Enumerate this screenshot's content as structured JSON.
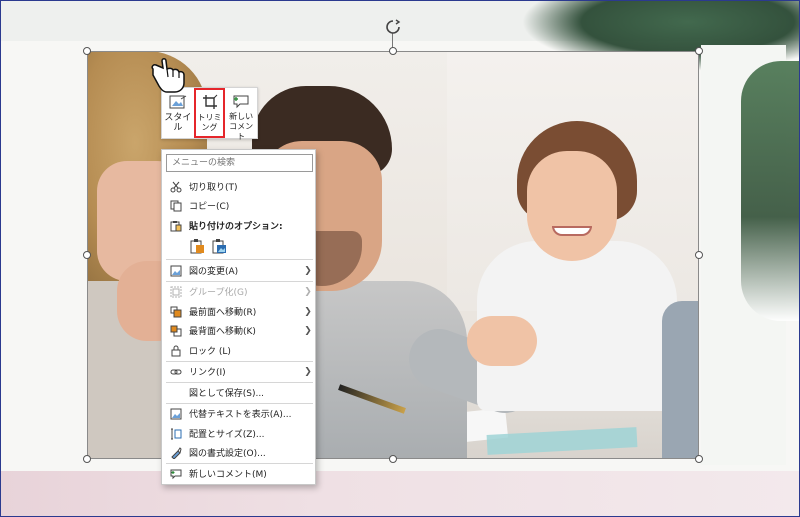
{
  "mini_toolbar": {
    "style_label": "スタイル",
    "crop_label": "トリミング",
    "new_comment_label": "新しいコメント"
  },
  "context_menu": {
    "search_placeholder": "メニューの検索",
    "cut": "切り取り(T)",
    "copy": "コピー(C)",
    "paste_options": "貼り付けのオプション:",
    "change_picture": "図の変更(A)",
    "group": "グループ化(G)",
    "bring_to_front": "最前面へ移動(R)",
    "send_to_back": "最背面へ移動(K)",
    "lock": "ロック (L)",
    "link": "リンク(I)",
    "save_as_picture": "図として保存(S)...",
    "alt_text": "代替テキストを表示(A)...",
    "size_position": "配置とサイズ(Z)...",
    "format_picture": "図の書式設定(O)...",
    "new_comment": "新しいコメント(M)"
  },
  "colors": {
    "highlight": "#e5262b",
    "accent_blue": "#2b6cb0",
    "accent_orange": "#e08a1e"
  }
}
